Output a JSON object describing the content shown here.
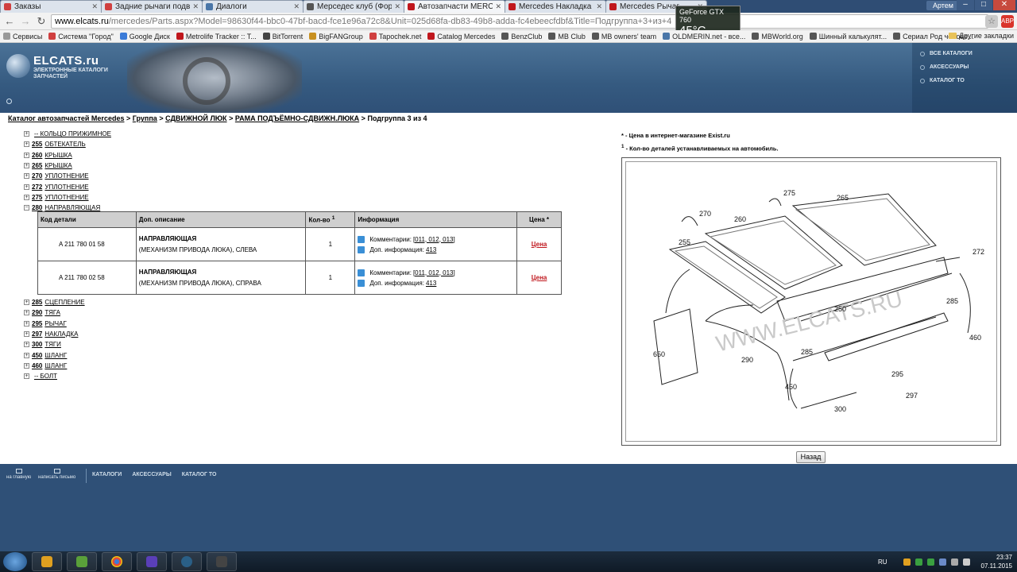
{
  "browser": {
    "tabs": [
      {
        "label": "Заказы",
        "color": "#d04040"
      },
      {
        "label": "Задние рычаги подвески",
        "color": "#d04040"
      },
      {
        "label": "Диалоги",
        "color": "#4a76a8"
      },
      {
        "label": "Мерседес клуб (Форум м",
        "color": "#555555"
      },
      {
        "label": "Автозапчасти MERCEDES",
        "color": "#c0171d",
        "active": true
      },
      {
        "label": "Mercedes Накладка",
        "color": "#c0171d"
      },
      {
        "label": "Mercedes Рычаг",
        "color": "#c0171d"
      }
    ],
    "user": "Артем",
    "url_host": "www.elcats.ru",
    "url_path": "/mercedes/Parts.aspx?Model=98630f44-bbc0-47bf-bacd-fce1e96a72c8&Unit=025d68fa-db83-49b8-adda-fc4ebeecfdbf&Title=Подгруппа+3+из+4",
    "gpu_name": "GeForce GTX 760",
    "gpu_temp": "45°C",
    "bookmarks": [
      "Сервисы",
      "Система \"Город\"",
      "Google Диск",
      "Metrolife Tracker :: T...",
      "BitTorrent",
      "BigFANGroup",
      "Tapochek.net",
      "Catalog Mercedes",
      "BenzClub",
      "MB Club",
      "MB owners' team",
      "OLDMERIN.net - все...",
      "MBWorld.org",
      "Шинный калькулят...",
      "Сериал Род челове..."
    ],
    "bookmarks_other": "Другие закладки"
  },
  "header": {
    "logo_name": "ELCATS.ru",
    "logo_line1": "ЭЛЕКТРОННЫЕ КАТАЛОГИ",
    "logo_line2": "ЗАПЧАСТЕЙ",
    "menu": [
      "ВСЕ КАТАЛОГИ",
      "АКСЕССУАРЫ",
      "КАТАЛОГ ТО"
    ]
  },
  "breadcrumb": {
    "catalog": "Каталог автозапчастей Mercedes",
    "group": "Группа",
    "g1": "СДВИЖНОЙ ЛЮК",
    "g2": "РАМА ПОДЪЁМНО-СДВИЖН.ЛЮКА",
    "current": "Подгруппа 3 из 4",
    "sep": ">"
  },
  "tree_before": [
    {
      "num": "",
      "name": "-- КОЛЬЦО ПРИЖИМНОЕ"
    },
    {
      "num": "255",
      "name": "ОБТЕКАТЕЛЬ"
    },
    {
      "num": "260",
      "name": "КРЫШКА"
    },
    {
      "num": "265",
      "name": "КРЫШКА"
    },
    {
      "num": "270",
      "name": "УПЛОТНЕНИЕ"
    },
    {
      "num": "272",
      "name": "УПЛОТНЕНИЕ"
    },
    {
      "num": "275",
      "name": "УПЛОТНЕНИЕ"
    }
  ],
  "tree_open": {
    "num": "280",
    "name": "НАПРАВЛЯЮЩАЯ"
  },
  "table": {
    "h_code": "Код детали",
    "h_desc": "Доп. описание",
    "h_qty": "Кол-во",
    "h_qty_sup": "1",
    "h_info": "Информация",
    "h_price": "Цена *",
    "comment_label": "Комментарии:",
    "info_label": "Доп. информация:",
    "rows": [
      {
        "code": "A 211 780 01 58",
        "title": "НАПРАВЛЯЮЩАЯ",
        "note": "(МЕХАНИЗМ ПРИВОДА ЛЮКА), СЛЕВА",
        "qty": "1",
        "comments": "[011, 012, 013]",
        "info": "413",
        "price": "Цена"
      },
      {
        "code": "A 211 780 02 58",
        "title": "НАПРАВЛЯЮЩАЯ",
        "note": "(МЕХАНИЗМ ПРИВОДА ЛЮКА), СПРАВА",
        "qty": "1",
        "comments": "[011, 012, 013]",
        "info": "413",
        "price": "Цена"
      }
    ]
  },
  "tree_after": [
    {
      "num": "285",
      "name": "СЦЕПЛЕНИЕ"
    },
    {
      "num": "290",
      "name": "ТЯГА"
    },
    {
      "num": "295",
      "name": "РЫЧАГ"
    },
    {
      "num": "297",
      "name": "НАКЛАДКА"
    },
    {
      "num": "300",
      "name": "ТЯГИ"
    },
    {
      "num": "450",
      "name": "ШЛАНГ"
    },
    {
      "num": "460",
      "name": "ШЛАНГ"
    },
    {
      "num": "",
      "name": "-- БОЛТ"
    }
  ],
  "legend": {
    "l1_mark": "*",
    "l1": " - Цена в интернет-магазине Exist.ru",
    "l2_mark": "1",
    "l2": " - Кол-во деталей устанавливаемых на автомобиль."
  },
  "diagram": {
    "watermark": "WWW.ELCATS.RU",
    "labels": [
      "275",
      "265",
      "270",
      "260",
      "255",
      "272",
      "250",
      "285",
      "460",
      "650",
      "285",
      "290",
      "295",
      "450",
      "297",
      "300"
    ]
  },
  "back_button": "Назад",
  "footer": {
    "home": "на главную",
    "mail": "написать письмо",
    "links": [
      "КАТАЛОГИ",
      "АКСЕССУАРЫ",
      "КАТАЛОГ ТО"
    ]
  },
  "taskbar": {
    "lang": "RU",
    "time": "23:37",
    "date": "07.11.2015"
  }
}
